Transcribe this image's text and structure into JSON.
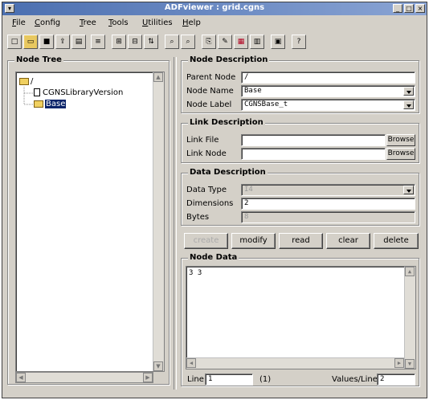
{
  "window": {
    "title": "ADFviewer : grid.cgns"
  },
  "menu": [
    {
      "key": "F",
      "rest": "ile"
    },
    {
      "key": "C",
      "rest": "onfig"
    },
    {
      "key": "T",
      "rest": "ree"
    },
    {
      "key": "T",
      "rest": "ools"
    },
    {
      "key": "U",
      "rest": "tilities"
    },
    {
      "key": "H",
      "rest": "elp"
    }
  ],
  "node_tree": {
    "title": "Node Tree",
    "root": "/",
    "items": [
      "CGNSLibraryVersion",
      "Base"
    ],
    "selected": "Base"
  },
  "node_description": {
    "title": "Node Description",
    "parent_label": "Parent Node",
    "parent_value": "/",
    "name_label": "Node Name",
    "name_value": "Base",
    "node_label_label": "Node Label",
    "node_label_value": "CGNSBase_t"
  },
  "link_description": {
    "title": "Link Description",
    "file_label": "Link File",
    "file_value": "",
    "node_label": "Link Node",
    "node_value": "",
    "browse": "Browse"
  },
  "data_description": {
    "title": "Data Description",
    "type_label": "Data Type",
    "type_value": "I4",
    "dims_label": "Dimensions",
    "dims_value": "2",
    "bytes_label": "Bytes",
    "bytes_value": "8"
  },
  "actions": {
    "create": "create",
    "modify": "modify",
    "read": "read",
    "clear": "clear",
    "delete": "delete"
  },
  "node_data": {
    "title": "Node Data",
    "content": "3 3",
    "line_label": "Line",
    "line_value": "1",
    "line_total": "(1)",
    "values_label": "Values/Line",
    "values_value": "2"
  }
}
